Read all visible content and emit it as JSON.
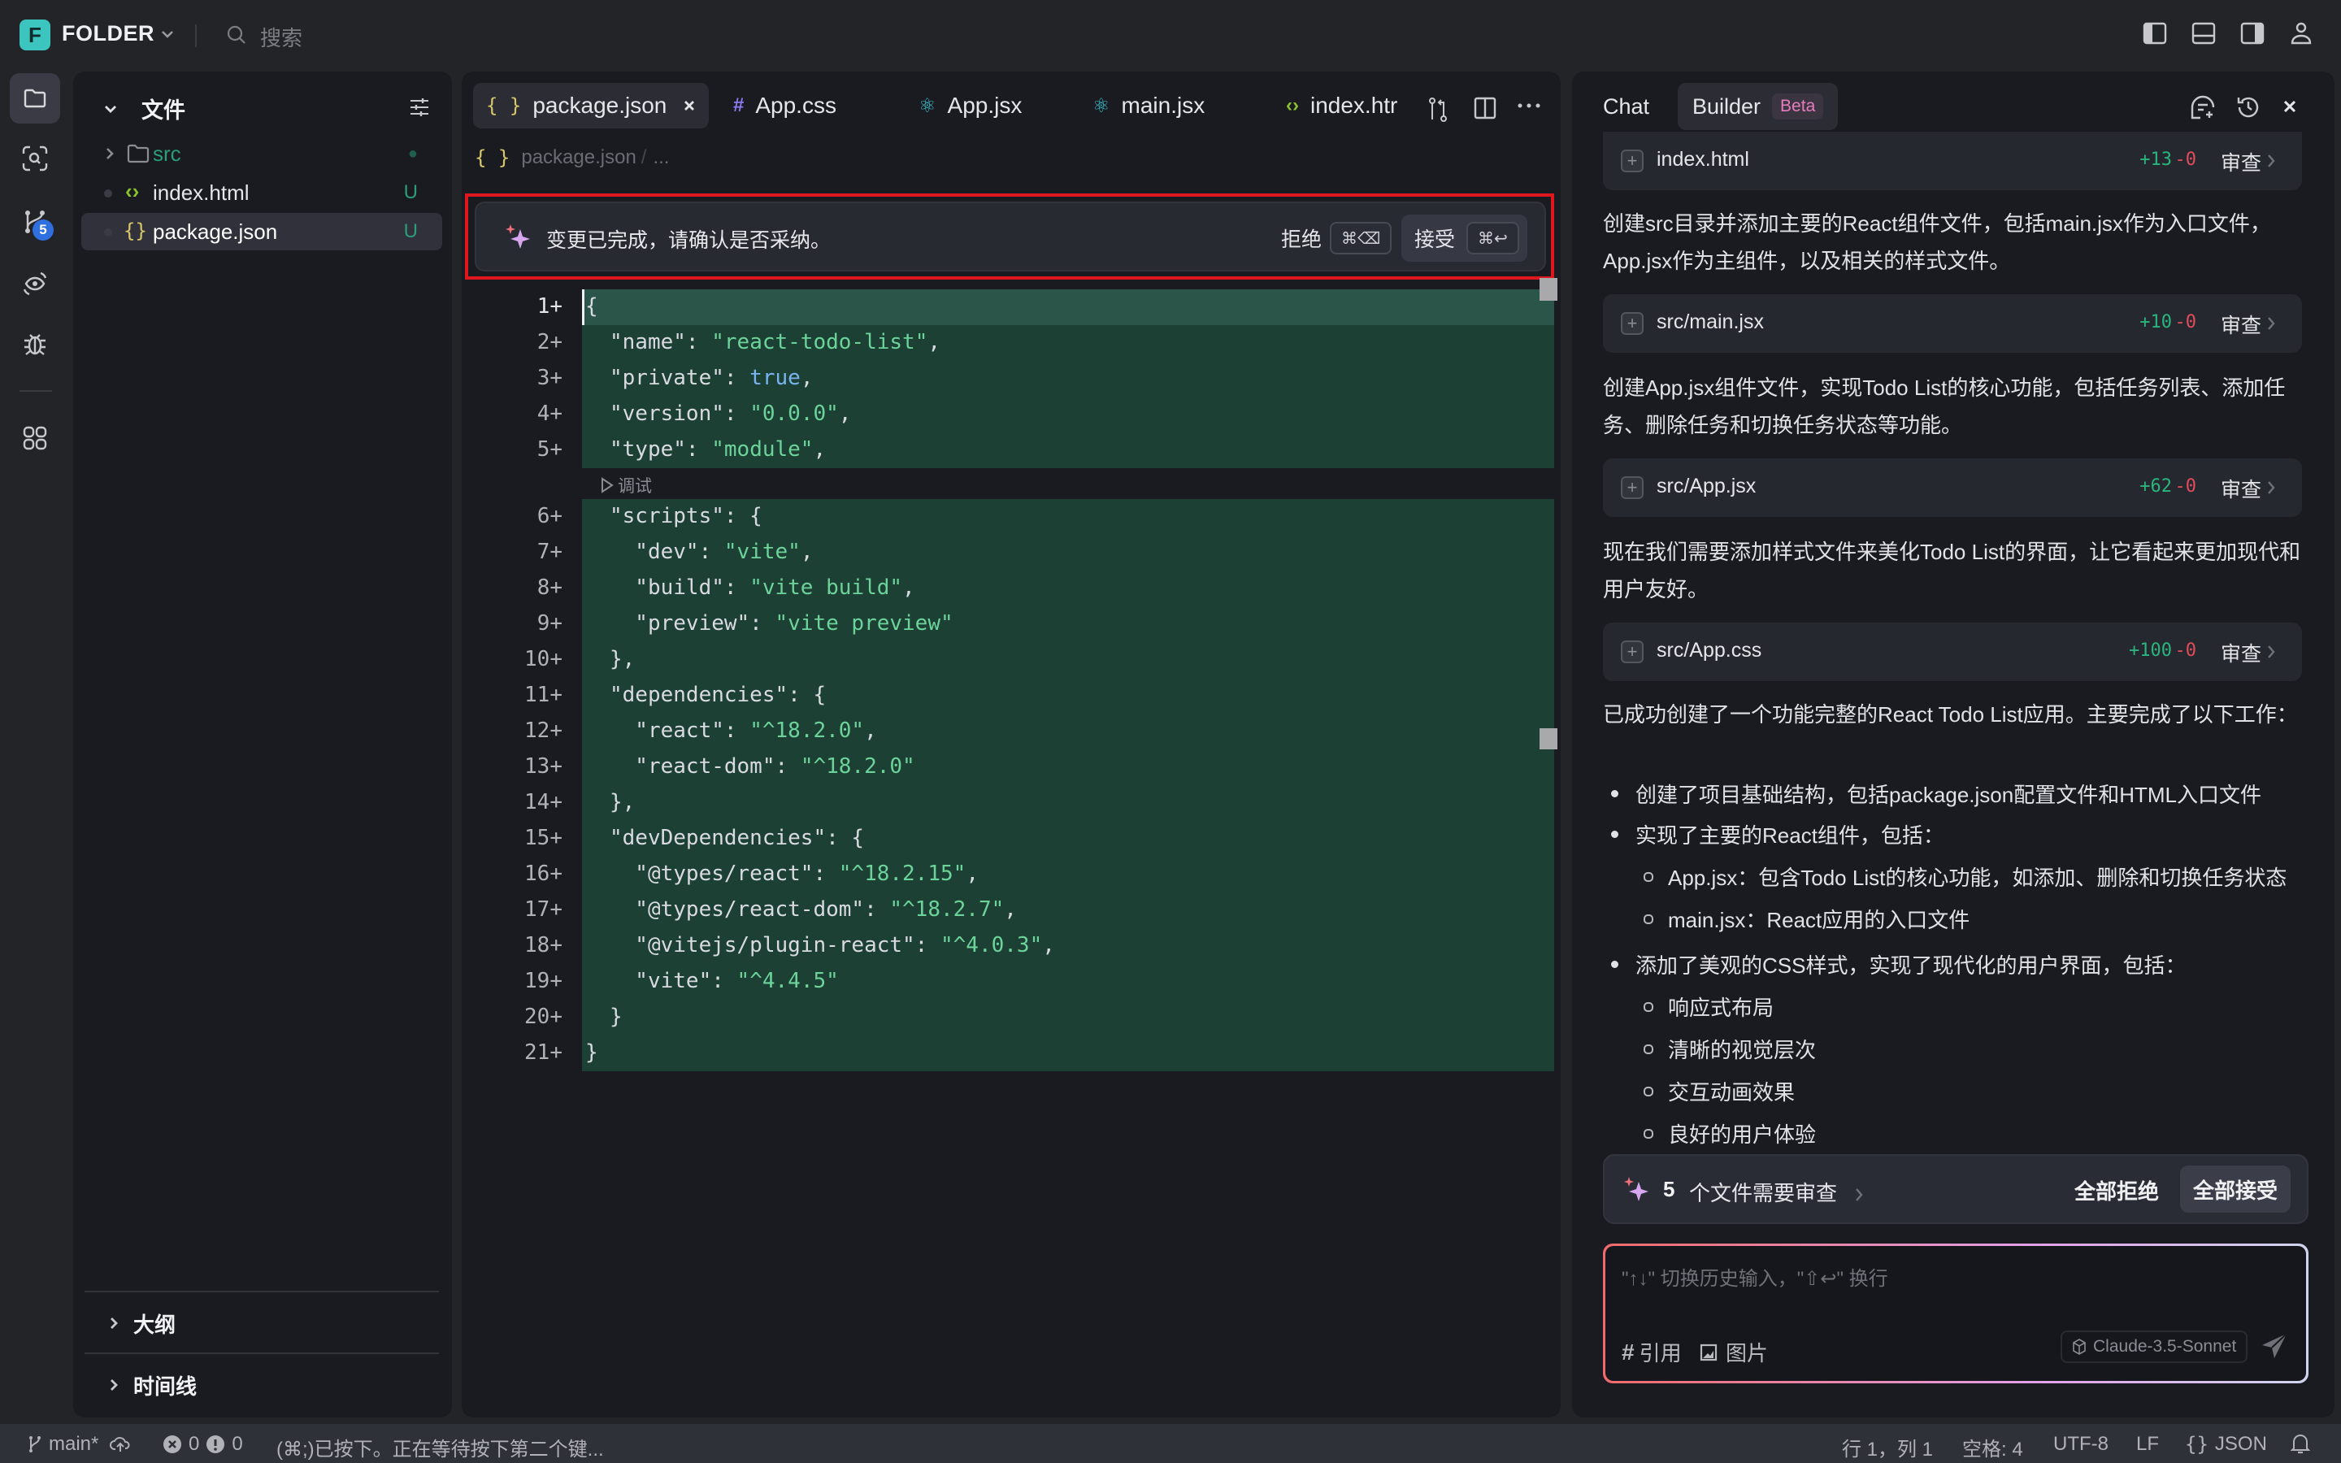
{
  "topbar": {
    "logo_letter": "F",
    "folder_name": "FOLDER",
    "search_placeholder": "搜索",
    "right_icons": [
      "toggle-left-panel-icon",
      "toggle-bottom-panel-icon",
      "toggle-right-panel-icon",
      "account-icon"
    ]
  },
  "activity_bar": {
    "items": [
      {
        "icon": "explorer-icon",
        "active": true
      },
      {
        "icon": "search-scan-icon"
      },
      {
        "icon": "source-control-icon",
        "badge": "5"
      },
      {
        "icon": "preview-eye-icon"
      },
      {
        "icon": "debug-bug-icon"
      },
      {
        "icon": "extensions-grid-icon"
      }
    ]
  },
  "explorer": {
    "title": "文件",
    "tree": [
      {
        "name": "src",
        "type": "folder",
        "status": "●",
        "color": "#2a9d79"
      },
      {
        "name": "index.html",
        "type": "html",
        "status": "U"
      },
      {
        "name": "package.json",
        "type": "json",
        "status": "U",
        "selected": true
      }
    ],
    "sections": [
      "大纲",
      "时间线"
    ]
  },
  "editor": {
    "tabs": [
      {
        "label": "package.json",
        "icon": "{ }",
        "active": true
      },
      {
        "label": "App.css",
        "icon": "#"
      },
      {
        "label": "App.jsx",
        "icon": "⚛"
      },
      {
        "label": "main.jsx",
        "icon": "⚛"
      },
      {
        "label": "index.htr",
        "icon": "‹›"
      }
    ],
    "breadcrumb": {
      "file": "package.json",
      "sep": "/",
      "rest": "..."
    },
    "banner": {
      "message": "变更已完成，请确认是否采纳。",
      "reject_label": "拒绝",
      "reject_kbd": "⌘⌫",
      "accept_label": "接受",
      "accept_kbd": "⌘↩"
    },
    "codelens": "调试",
    "lines": [
      {
        "n": "1+",
        "html": "{"
      },
      {
        "n": "2+",
        "html": "\"name\": <span class='s'>\"react-todo-list\"</span>,"
      },
      {
        "n": "3+",
        "html": "\"private\": <span class='b'>true</span>,"
      },
      {
        "n": "4+",
        "html": "\"version\": <span class='s'>\"0.0.0\"</span>,"
      },
      {
        "n": "5+",
        "html": "\"type\": <span class='s'>\"module\"</span>,"
      },
      {
        "n": "6+",
        "html": "\"scripts\": {"
      },
      {
        "n": "7+",
        "html": "  \"dev\": <span class='s'>\"vite\"</span>,"
      },
      {
        "n": "8+",
        "html": "  \"build\": <span class='s'>\"vite build\"</span>,"
      },
      {
        "n": "9+",
        "html": "  \"preview\": <span class='s'>\"vite preview\"</span>"
      },
      {
        "n": "10+",
        "html": "},"
      },
      {
        "n": "11+",
        "html": "\"dependencies\": {"
      },
      {
        "n": "12+",
        "html": "  \"react\": <span class='s'>\"^18.2.0\"</span>,"
      },
      {
        "n": "13+",
        "html": "  \"react-dom\": <span class='s'>\"^18.2.0\"</span>"
      },
      {
        "n": "14+",
        "html": "},"
      },
      {
        "n": "15+",
        "html": "\"devDependencies\": {"
      },
      {
        "n": "16+",
        "html": "  \"@types/react\": <span class='s'>\"^18.2.15\"</span>,"
      },
      {
        "n": "17+",
        "html": "  \"@types/react-dom\": <span class='s'>\"^18.2.7\"</span>,"
      },
      {
        "n": "18+",
        "html": "  \"@vitejs/plugin-react\": <span class='s'>\"^4.0.3\"</span>,"
      },
      {
        "n": "19+",
        "html": "  \"vite\": <span class='s'>\"^4.4.5\"</span>"
      },
      {
        "n": "20+",
        "html": "}"
      },
      {
        "n": "21+",
        "html": "}"
      }
    ]
  },
  "chat": {
    "tabs": {
      "chat": "Chat",
      "builder": "Builder",
      "beta": "Beta"
    },
    "header_icons": [
      "new-chat-icon",
      "history-icon",
      "close-icon"
    ],
    "file_cards": [
      {
        "name": "index.html",
        "add": "+13",
        "del": "-0",
        "action": "审查"
      },
      {
        "name": "src/main.jsx",
        "add": "+10",
        "del": "-0",
        "action": "审查"
      },
      {
        "name": "src/App.jsx",
        "add": "+62",
        "del": "-0",
        "action": "审查"
      },
      {
        "name": "src/App.css",
        "add": "+100",
        "del": "-0",
        "action": "审查"
      }
    ],
    "paragraphs": [
      "创建src目录并添加主要的React组件文件，包括main.jsx作为入口文件，App.jsx作为主组件，以及相关的样式文件。",
      "创建App.jsx组件文件，实现Todo List的核心功能，包括任务列表、添加任务、删除任务和切换任务状态等功能。",
      "现在我们需要添加样式文件来美化Todo List的界面，让它看起来更加现代和用户友好。",
      "已成功创建了一个功能完整的React Todo List应用。主要完成了以下工作："
    ],
    "summary_list": {
      "item1": "创建了项目基础结构，包括package.json配置文件和HTML入口文件",
      "item2": "实现了主要的React组件，包括：",
      "item2_sub": [
        "App.jsx：包含Todo List的核心功能，如添加、删除和切换任务状态",
        "main.jsx：React应用的入口文件"
      ],
      "item3": "添加了美观的CSS样式，实现了现代化的用户界面，包括：",
      "item3_sub": [
        "响应式布局",
        "清晰的视觉层次",
        "交互动画效果",
        "良好的用户体验"
      ]
    },
    "review_bar": {
      "count": "5",
      "text": "个文件需要审查",
      "reject_all": "全部拒绝",
      "accept_all": "全部接受"
    },
    "input": {
      "placeholder": "\"↑↓\" 切换历史输入，\"⇧↩\" 换行",
      "ref_label": "引用",
      "image_label": "图片",
      "model": "Claude-3.5-Sonnet"
    }
  },
  "statusbar": {
    "branch": "main*",
    "errors": "0",
    "warnings": "0",
    "message": "(⌘;)已按下。正在等待按下第二个键...",
    "position": "行 1，列 1",
    "spaces": "空格: 4",
    "encoding": "UTF-8",
    "eol": "LF",
    "language": "JSON"
  },
  "colors": {
    "accent": "#3cc4be",
    "diff_add_bg": "#1c4034",
    "highlight_border": "#e0161e",
    "add": "#2ab57d",
    "del": "#e04c5a"
  }
}
